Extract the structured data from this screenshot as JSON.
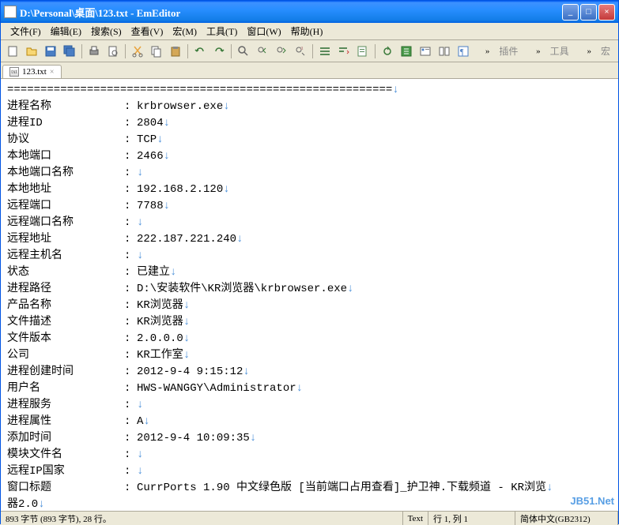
{
  "titlebar": {
    "title": "D:\\Personal\\桌面\\123.txt - EmEditor"
  },
  "menus": {
    "file": "文件(F)",
    "edit": "编辑(E)",
    "search": "搜索(S)",
    "view": "查看(V)",
    "macro": "宏(M)",
    "tools": "工具(T)",
    "window": "窗口(W)",
    "help": "帮助(H)"
  },
  "right_labels": {
    "plugins": "插件",
    "tools": "工具",
    "macro": "宏"
  },
  "tab": {
    "label": "123.txt"
  },
  "divider": "==========================================================↓",
  "rows": [
    {
      "k": "进程名称",
      "v": "krbrowser.exe"
    },
    {
      "k": "进程ID",
      "v": "2804"
    },
    {
      "k": "协议",
      "v": "TCP"
    },
    {
      "k": "本地端口",
      "v": "2466"
    },
    {
      "k": "本地端口名称",
      "v": ""
    },
    {
      "k": "本地地址",
      "v": "192.168.2.120"
    },
    {
      "k": "远程端口",
      "v": "7788"
    },
    {
      "k": "远程端口名称",
      "v": ""
    },
    {
      "k": "远程地址",
      "v": "222.187.221.240"
    },
    {
      "k": "远程主机名",
      "v": ""
    },
    {
      "k": "状态",
      "v": "已建立"
    },
    {
      "k": "进程路径",
      "v": "D:\\安装软件\\KR浏览器\\krbrowser.exe"
    },
    {
      "k": "产品名称",
      "v": "KR浏览器"
    },
    {
      "k": "文件描述",
      "v": "KR浏览器"
    },
    {
      "k": "文件版本",
      "v": "2.0.0.0"
    },
    {
      "k": "公司",
      "v": "KR工作室"
    },
    {
      "k": "进程创建时间",
      "v": "2012-9-4 9:15:12"
    },
    {
      "k": "用户名",
      "v": "HWS-WANGGY\\Administrator"
    },
    {
      "k": "进程服务",
      "v": ""
    },
    {
      "k": "进程属性",
      "v": "A"
    },
    {
      "k": "添加时间",
      "v": "2012-9-4 10:09:35"
    },
    {
      "k": "模块文件名",
      "v": ""
    },
    {
      "k": "远程IP国家",
      "v": ""
    },
    {
      "k": "窗口标题",
      "v": "CurrPorts 1.90 中文绿色版 [当前端口占用查看]_护卫神.下载频道 - KR浏览"
    }
  ],
  "last_line": "器2.0",
  "statusbar": {
    "bytes": "893 字节 (893 字节), 28 行。",
    "text": "Text",
    "pos": "行 1, 列 1",
    "encoding": "简体中文(GB2312)"
  },
  "watermark": "JB51.Net"
}
